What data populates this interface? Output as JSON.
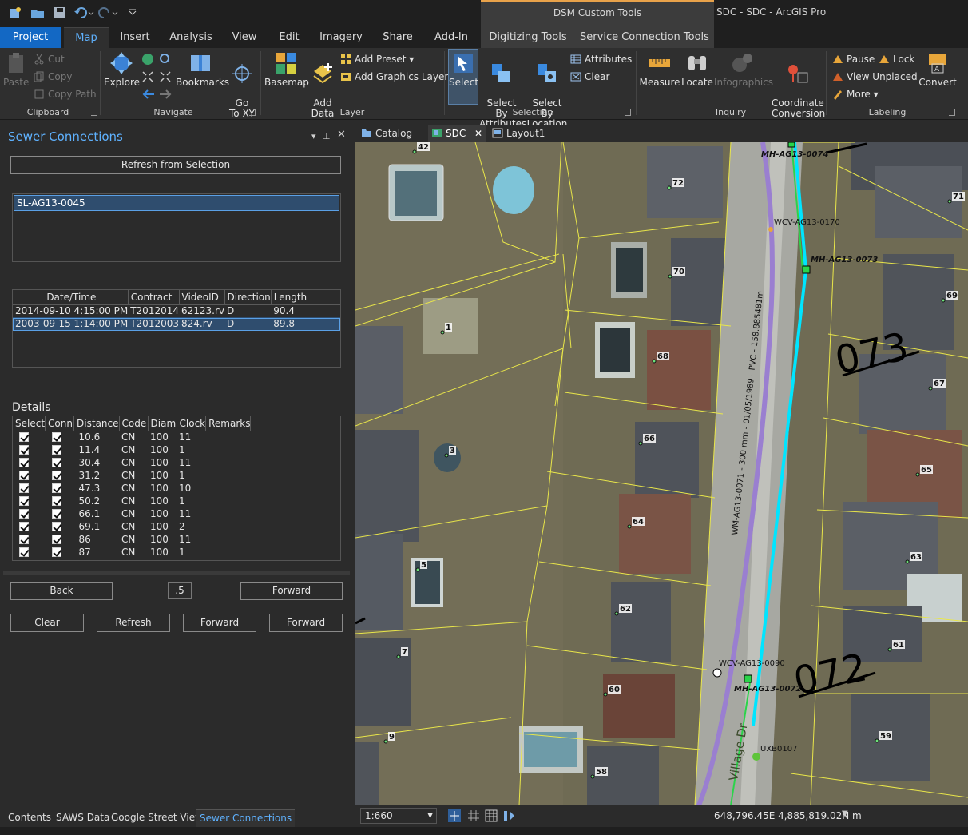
{
  "window": {
    "custom_tab_header": "DSM Custom Tools",
    "title": "SDC - SDC - ArcGIS Pro"
  },
  "ribbon_tabs": [
    "Project",
    "Map",
    "Insert",
    "Analysis",
    "View",
    "Edit",
    "Imagery",
    "Share",
    "Add-In",
    "Digitizing Tools",
    "Service Connection Tools"
  ],
  "clipboard": {
    "paste": "Paste",
    "cut": "Cut",
    "copy": "Copy",
    "copy_path": "Copy Path",
    "label": "Clipboard"
  },
  "navigate": {
    "explore": "Explore",
    "bookmarks": "Bookmarks",
    "go_to_xy": "Go\nTo XY",
    "label": "Navigate"
  },
  "layer": {
    "basemap": "Basemap",
    "add_data": "Add\nData",
    "add_preset": "Add Preset",
    "add_graphics_layer": "Add Graphics Layer",
    "label": "Layer"
  },
  "selection": {
    "select": "Select",
    "select_by_attributes": "Select By\nAttributes",
    "select_by_location": "Select By\nLocation",
    "attributes": "Attributes",
    "clear": "Clear",
    "label": "Selection"
  },
  "inquiry": {
    "measure": "Measure",
    "locate": "Locate",
    "infographics": "Infographics",
    "coordinate_conversion": "Coordinate\nConversion",
    "label": "Inquiry"
  },
  "labeling": {
    "pause": "Pause",
    "lock": "Lock",
    "view_unplaced": "View Unplaced",
    "more": "More",
    "convert": "Convert",
    "label": "Labeling"
  },
  "pane": {
    "title": "Sewer Connections",
    "refresh_from_selection": "Refresh from Selection",
    "selected_lateral": "SL-AG13-0045",
    "inspections": {
      "columns": [
        "Date/Time",
        "Contract",
        "VideoID",
        "Direction",
        "Length"
      ],
      "rows": [
        [
          "2014-09-10 4:15:00 PM",
          "T2012014",
          "62123.rv",
          "D",
          "90.4"
        ],
        [
          "2003-09-15 1:14:00 PM",
          "T2012003",
          "824.rv",
          "D",
          "89.8"
        ]
      ]
    },
    "details_label": "Details",
    "details": {
      "columns": [
        "Select",
        "Conn",
        "Distance",
        "Code",
        "Diam",
        "Clock",
        "Remarks"
      ],
      "rows": [
        [
          "10.6",
          "CN",
          "100",
          "11",
          ""
        ],
        [
          "11.4",
          "CN",
          "100",
          "1",
          ""
        ],
        [
          "30.4",
          "CN",
          "100",
          "11",
          ""
        ],
        [
          "31.2",
          "CN",
          "100",
          "1",
          ""
        ],
        [
          "47.3",
          "CN",
          "100",
          "10",
          ""
        ],
        [
          "50.2",
          "CN",
          "100",
          "1",
          ""
        ],
        [
          "66.1",
          "CN",
          "100",
          "11",
          ""
        ],
        [
          "69.1",
          "CN",
          "100",
          "2",
          ""
        ],
        [
          "86",
          "CN",
          "100",
          "11",
          ""
        ],
        [
          "87",
          "CN",
          "100",
          "1",
          ""
        ]
      ]
    },
    "back": "Back",
    "step_value": ".5",
    "forward_top": "Forward",
    "clear": "Clear",
    "refresh": "Refresh",
    "forward_1": "Forward",
    "forward_2": "Forward"
  },
  "bottom_tabs": [
    "Contents",
    "SAWS Data",
    "Google Street View",
    "Sewer Connections"
  ],
  "view_tabs": [
    "Catalog",
    "SDC",
    "Layout1"
  ],
  "map": {
    "house_numbers": [
      "42",
      "72",
      "71",
      "70",
      "69",
      "1",
      "68",
      "67",
      "66",
      "3",
      "65",
      "64",
      "5",
      "63",
      "62",
      "61",
      "7",
      "60",
      "59",
      "9",
      "58"
    ],
    "manholes": [
      "MH-AG13-0074",
      "MH-AG13-0073",
      "MH-AG13-0072"
    ],
    "valves": [
      "WCV-AG13-0170",
      "WCV-AG13-0090"
    ],
    "main_label": "WM-AG13-0071 - 300 mm - 01/05/1989 - PVC - 158.885481m",
    "handwritten": [
      "073",
      "072"
    ],
    "misc_label": "UXB0107",
    "street_label": "Village Dr"
  },
  "status": {
    "scale": "1:660",
    "coordinates": "648,796.45E 4,885,819.02N m"
  }
}
